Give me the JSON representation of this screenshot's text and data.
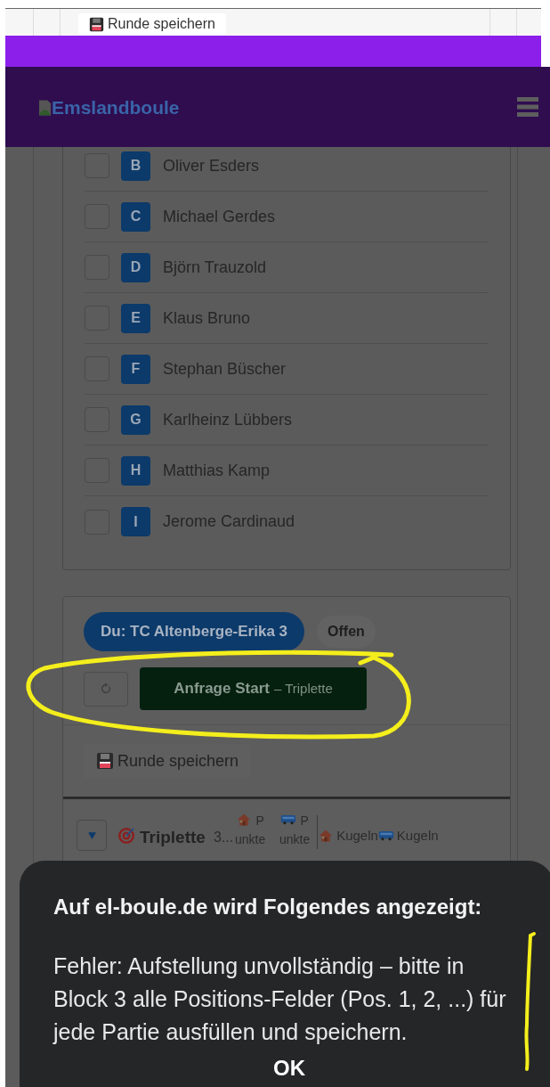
{
  "top_strip": {
    "save_button": {
      "label": "Runde speichern"
    }
  },
  "header": {
    "brand": "Emslandboule"
  },
  "players": [
    {
      "letter": "B",
      "name": "Oliver Esders",
      "checked": false
    },
    {
      "letter": "C",
      "name": "Michael Gerdes",
      "checked": false
    },
    {
      "letter": "D",
      "name": "Björn Trauzold",
      "checked": false
    },
    {
      "letter": "E",
      "name": "Klaus Bruno",
      "checked": false
    },
    {
      "letter": "F",
      "name": "Stephan Büscher",
      "checked": false
    },
    {
      "letter": "G",
      "name": "Karlheinz Lübbers",
      "checked": false
    },
    {
      "letter": "H",
      "name": "Matthias Kamp",
      "checked": false
    },
    {
      "letter": "I",
      "name": "Jerome Cardinaud",
      "checked": false
    }
  ],
  "team_card": {
    "team": "Du: TC Altenberge-Erika 3",
    "status": "Offen",
    "request_button": {
      "label": "Anfrage Start",
      "suffix": "– Triplette"
    },
    "save_button": {
      "label": "Runde speichern"
    }
  },
  "match_table": {
    "expanded": false,
    "game": "Triplette",
    "column_1": "3...",
    "columns": [
      {
        "kind": "home",
        "label": "Punkte"
      },
      {
        "kind": "away",
        "label": "Punkte"
      },
      {
        "kind": "home",
        "label": "Kugeln"
      },
      {
        "kind": "away",
        "label": "Kugeln"
      }
    ]
  },
  "dialog": {
    "title": "Auf el-boule.de wird Folgendes angezeigt:",
    "message": "Fehler: Aufstellung unvollständig – bitte in Block 3 alle Positions-Felder (Pos. 1, 2, ...) für jede Partie ausfüllen und speichern.",
    "ok_button": "OK"
  }
}
